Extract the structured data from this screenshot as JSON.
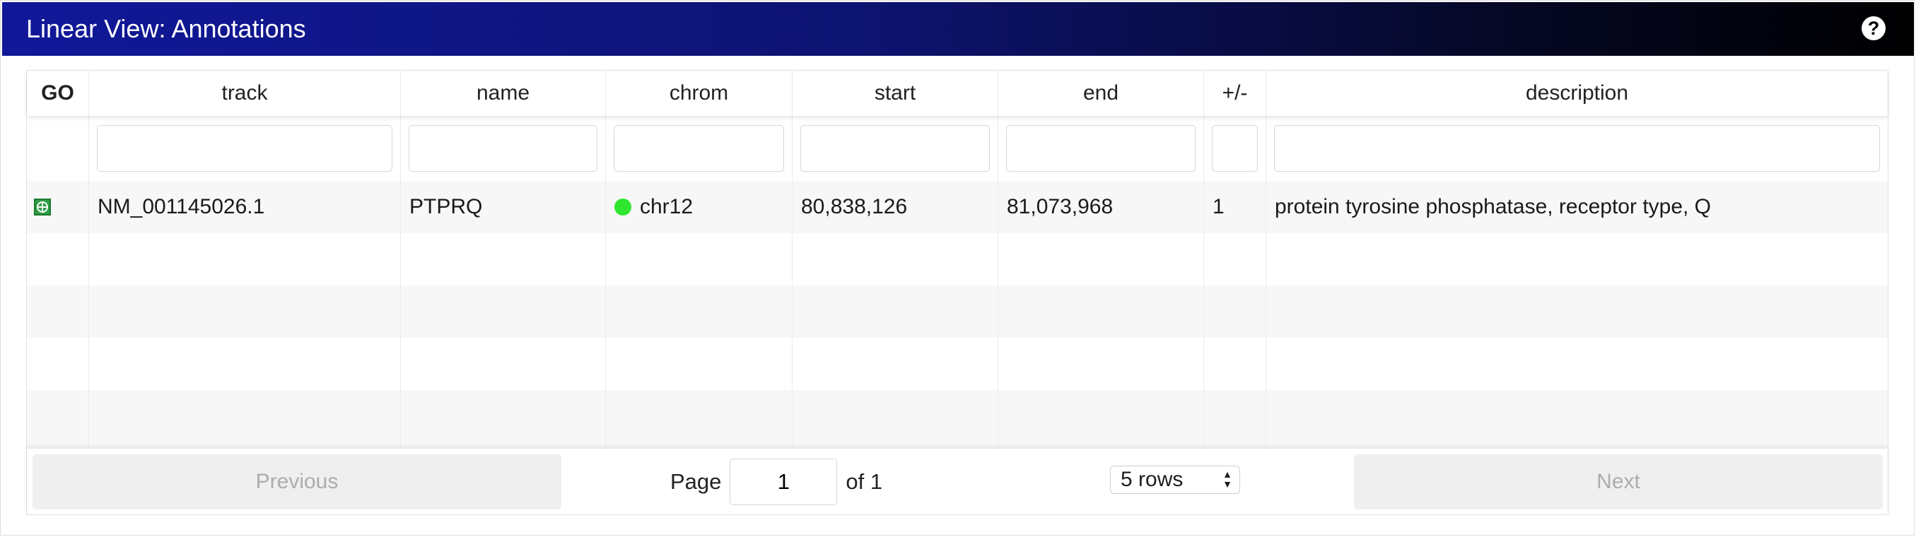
{
  "panel": {
    "title": "Linear View: Annotations",
    "help_icon": "question-circle-icon"
  },
  "table": {
    "columns": [
      "GO",
      "track",
      "name",
      "chrom",
      "start",
      "end",
      "+/-",
      "description"
    ],
    "rows": [
      {
        "go_icon": "go-to-target-icon",
        "track": "NM_001145026.1",
        "name": "PTPRQ",
        "chrom": "chr12",
        "chrom_color": "#2ee62e",
        "start": "80,838,126",
        "end": "81,073,968",
        "strand": "1",
        "description": "protein tyrosine phosphatase, receptor type, Q"
      }
    ]
  },
  "pagination": {
    "previous_label": "Previous",
    "next_label": "Next",
    "page_label": "Page",
    "page_value": "1",
    "of_label": "of 1",
    "rows_label": "5 rows"
  },
  "colors": {
    "title_start": "#11189a",
    "title_end": "#000000",
    "go_green": "#2f9e44"
  }
}
